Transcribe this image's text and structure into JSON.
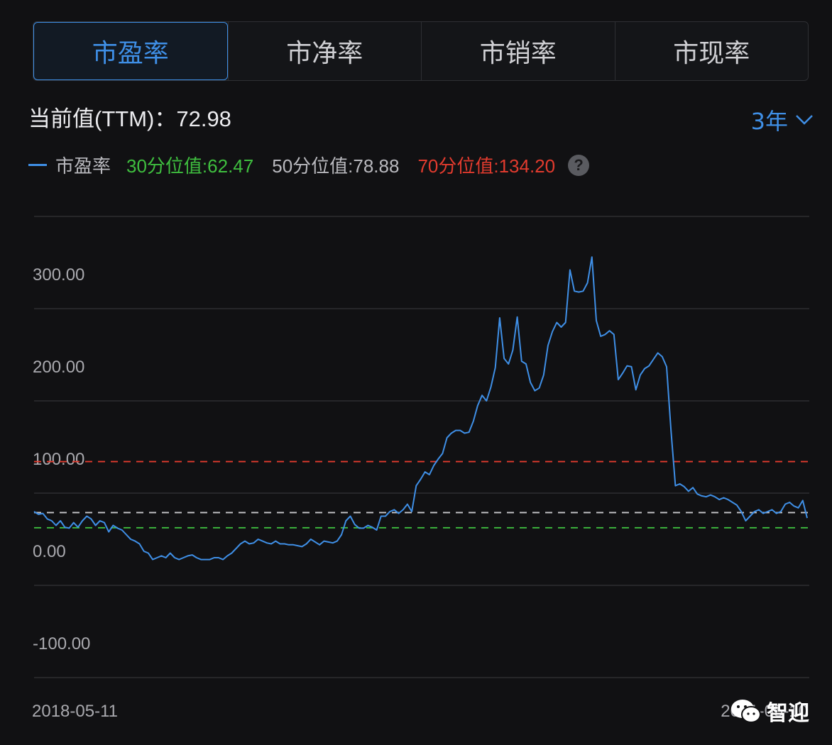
{
  "tabs": [
    {
      "label": "市盈率",
      "active": true
    },
    {
      "label": "市净率",
      "active": false
    },
    {
      "label": "市销率",
      "active": false
    },
    {
      "label": "市现率",
      "active": false
    }
  ],
  "current": {
    "label": "当前值(TTM)：",
    "value": "72.98"
  },
  "period": {
    "label": "3年"
  },
  "legend": {
    "series_name": "市盈率",
    "p30": "30分位值:62.47",
    "p50": "50分位值:78.88",
    "p70": "70分位值:134.20"
  },
  "x_axis": {
    "start_label": "2018-05-11",
    "end_label": "2021-05-10"
  },
  "watermark": {
    "text": "智迎"
  },
  "colors": {
    "series": "#3f8fe6",
    "p30": "#3fbf3f",
    "p50": "#c8c8cc",
    "p70": "#e23b2e",
    "grid": "#3a3b3f",
    "tick_text": "#a9a9ae"
  },
  "chart_data": {
    "type": "line",
    "title": "",
    "ylim": [
      -100,
      400
    ],
    "yticks": [
      -100,
      0,
      100,
      200,
      300
    ],
    "ytick_labels": [
      "-100.00",
      "0.00",
      "100.00",
      "200.00",
      "300.00"
    ],
    "grid": true,
    "reference_lines": [
      {
        "name": "30分位值",
        "value": 62.47
      },
      {
        "name": "50分位值",
        "value": 78.88
      },
      {
        "name": "70分位值",
        "value": 134.2
      }
    ],
    "series": [
      {
        "name": "市盈率",
        "values": [
          80,
          77,
          78,
          72,
          70,
          65,
          70,
          63,
          62,
          68,
          63,
          70,
          75,
          72,
          65,
          70,
          68,
          58,
          65,
          62,
          60,
          55,
          50,
          48,
          45,
          37,
          35,
          28,
          30,
          32,
          30,
          35,
          30,
          28,
          30,
          32,
          33,
          30,
          28,
          28,
          28,
          30,
          30,
          28,
          32,
          35,
          40,
          45,
          48,
          45,
          46,
          50,
          48,
          46,
          45,
          48,
          45,
          45,
          44,
          44,
          43,
          42,
          45,
          50,
          47,
          44,
          48,
          47,
          46,
          48,
          55,
          70,
          75,
          66,
          62,
          62,
          65,
          63,
          60,
          75,
          75,
          80,
          82,
          78,
          82,
          88,
          80,
          108,
          115,
          123,
          120,
          130,
          137,
          143,
          160,
          165,
          168,
          168,
          165,
          166,
          178,
          195,
          206,
          200,
          215,
          236,
          290,
          246,
          240,
          255,
          291,
          243,
          240,
          220,
          211,
          214,
          228,
          260,
          275,
          285,
          280,
          285,
          342,
          319,
          318,
          319,
          328,
          356,
          287,
          270,
          272,
          276,
          272,
          223,
          230,
          238,
          237,
          212,
          228,
          235,
          238,
          245,
          252,
          248,
          237,
          168,
          108,
          110,
          107,
          102,
          106,
          99,
          97,
          96,
          98,
          96,
          93,
          95,
          93,
          90,
          87,
          80,
          70,
          75,
          80,
          82,
          78,
          80,
          82,
          78,
          80,
          88,
          90,
          86,
          84,
          92,
          73
        ]
      }
    ]
  }
}
